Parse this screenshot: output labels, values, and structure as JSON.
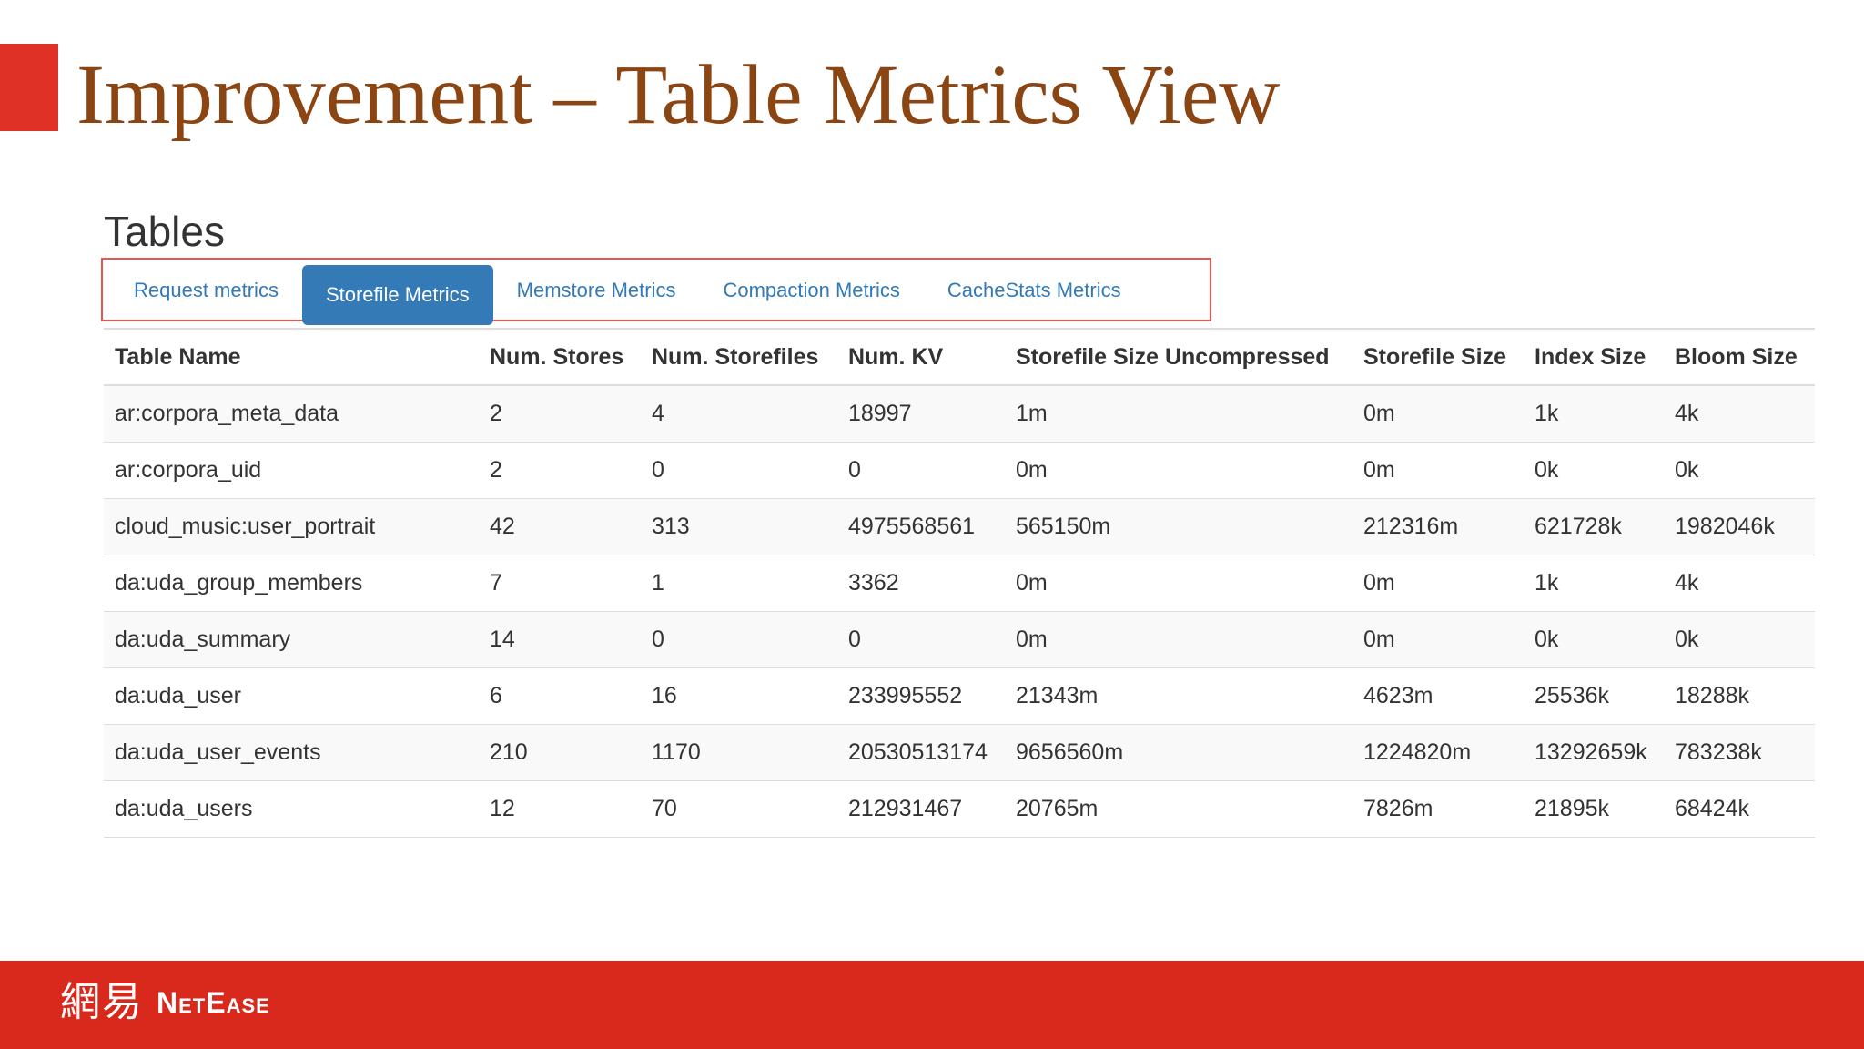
{
  "slide": {
    "title": "Improvement – Table Metrics View"
  },
  "section": {
    "heading": "Tables"
  },
  "tabs": [
    {
      "label": "Request metrics",
      "active": false
    },
    {
      "label": "Storefile Metrics",
      "active": true
    },
    {
      "label": "Memstore Metrics",
      "active": false
    },
    {
      "label": "Compaction Metrics",
      "active": false
    },
    {
      "label": "CacheStats Metrics",
      "active": false
    }
  ],
  "table": {
    "columns": [
      "Table Name",
      "Num. Stores",
      "Num. Storefiles",
      "Num. KV",
      "Storefile Size Uncompressed",
      "Storefile Size",
      "Index Size",
      "Bloom Size"
    ],
    "rows": [
      [
        "ar:corpora_meta_data",
        "2",
        "4",
        "18997",
        "1m",
        "0m",
        "1k",
        "4k"
      ],
      [
        "ar:corpora_uid",
        "2",
        "0",
        "0",
        "0m",
        "0m",
        "0k",
        "0k"
      ],
      [
        "cloud_music:user_portrait",
        "42",
        "313",
        "4975568561",
        "565150m",
        "212316m",
        "621728k",
        "1982046k"
      ],
      [
        "da:uda_group_members",
        "7",
        "1",
        "3362",
        "0m",
        "0m",
        "1k",
        "4k"
      ],
      [
        "da:uda_summary",
        "14",
        "0",
        "0",
        "0m",
        "0m",
        "0k",
        "0k"
      ],
      [
        "da:uda_user",
        "6",
        "16",
        "233995552",
        "21343m",
        "4623m",
        "25536k",
        "18288k"
      ],
      [
        "da:uda_user_events",
        "210",
        "1170",
        "20530513174",
        "9656560m",
        "1224820m",
        "13292659k",
        "783238k"
      ],
      [
        "da:uda_users",
        "12",
        "70",
        "212931467",
        "20765m",
        "7826m",
        "21895k",
        "68424k"
      ]
    ]
  },
  "footer": {
    "logo_glyphs": "網易",
    "logo_word": "NetEase"
  },
  "colors": {
    "accent": "#e03127",
    "title": "#8b4513",
    "tab_link": "#337ab7",
    "footer": "#d9291c"
  }
}
